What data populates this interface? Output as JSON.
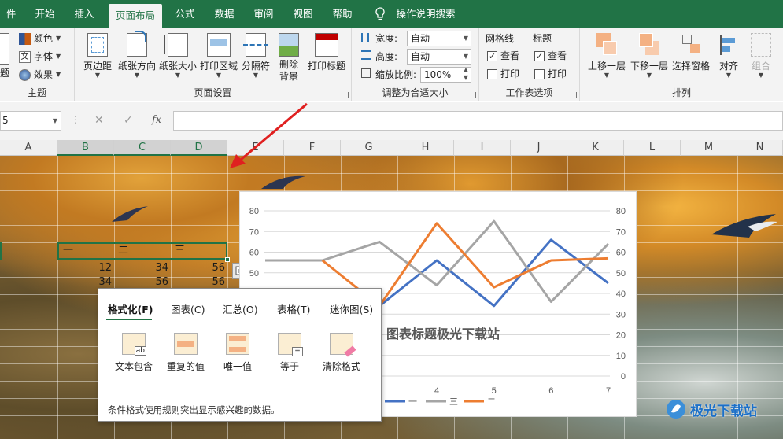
{
  "ribbon_tabs": [
    "件",
    "开始",
    "插入",
    "页面布局",
    "公式",
    "数据",
    "审阅",
    "视图",
    "帮助",
    "操作说明搜索"
  ],
  "active_tab": "页面布局",
  "theme_group": {
    "label": "主题",
    "partial_label": "题",
    "colors": "颜色",
    "fonts": "字体",
    "effects": "效果"
  },
  "page_setup": {
    "label": "页面设置",
    "buttons": [
      "页边距",
      "纸张方向",
      "纸张大小",
      "打印区域",
      "分隔符",
      "删除背景",
      "打印标题"
    ]
  },
  "scale": {
    "label": "调整为合适大小",
    "width_label": "宽度:",
    "width_value": "自动",
    "height_label": "高度:",
    "height_value": "自动",
    "zoom_label": "缩放比例:",
    "zoom_value": "100%"
  },
  "sheet_options": {
    "label": "工作表选项",
    "gridlines": "网格线",
    "headings": "标题",
    "view": "查看",
    "print": "打印"
  },
  "arrange": {
    "label": "排列",
    "buttons": [
      "上移一层",
      "下移一层",
      "选择窗格",
      "对齐",
      "组合"
    ]
  },
  "formula_bar": {
    "name_box": "5",
    "cancel": "✕",
    "enter": "✓",
    "fx": "fx",
    "content": "一"
  },
  "columns": [
    "A",
    "B",
    "C",
    "D",
    "E",
    "F",
    "G",
    "H",
    "I",
    "J",
    "K",
    "L",
    "M",
    "N"
  ],
  "cells": {
    "header": [
      "一",
      "二",
      "三"
    ],
    "row1": [
      "12",
      "34",
      "56"
    ],
    "row2": [
      "34",
      "56",
      "56"
    ]
  },
  "quick_analysis": {
    "tabs": [
      "格式化(F)",
      "图表(C)",
      "汇总(O)",
      "表格(T)",
      "迷你图(S)"
    ],
    "items": [
      "文本包含",
      "重复的值",
      "唯一值",
      "等于",
      "清除格式"
    ],
    "description": "条件格式使用规则突出显示感兴趣的数据。"
  },
  "watermark": "极光下载站",
  "chart_data": {
    "type": "line",
    "title": "图表标题极光下载站",
    "x": [
      1,
      2,
      3,
      4,
      5,
      6,
      7
    ],
    "x_tick_labels_visible": [
      "3",
      "4",
      "5",
      "6",
      "7"
    ],
    "ylim": [
      0,
      80
    ],
    "yticks": [
      0,
      10,
      20,
      30,
      40,
      50,
      60,
      70,
      80
    ],
    "secondary_ylim": [
      0,
      80
    ],
    "grid": true,
    "legend_position": "bottom",
    "series": [
      {
        "name": "一",
        "color": "#4472c4",
        "values": [
          null,
          null,
          34,
          56,
          34,
          66,
          45
        ]
      },
      {
        "name": "三",
        "color": "#a5a5a5",
        "values": [
          56,
          56,
          65,
          44,
          75,
          36,
          64
        ]
      },
      {
        "name": "二",
        "color": "#ed7d31",
        "values": [
          null,
          56,
          34,
          74,
          43,
          56,
          57
        ]
      }
    ]
  }
}
